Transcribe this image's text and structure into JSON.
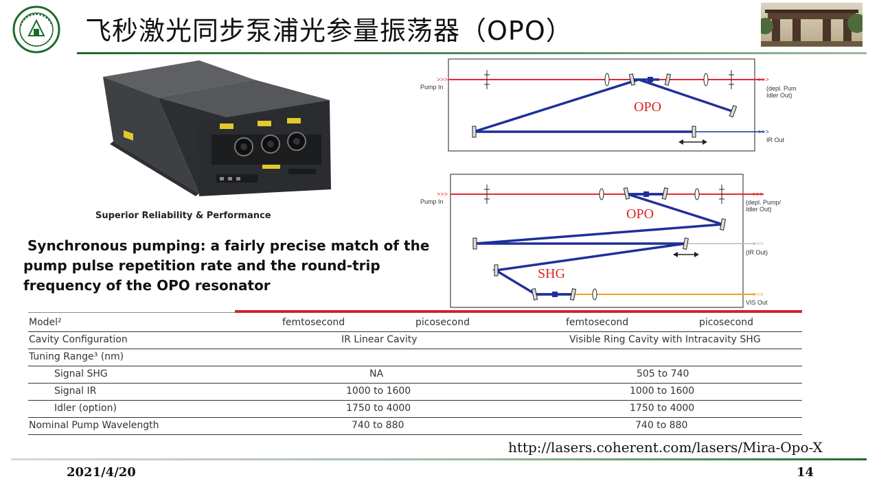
{
  "header": {
    "title": "飞秒激光同步泵浦光参量振荡器（OPO）"
  },
  "product": {
    "caption": "Superior Reliability & Performance"
  },
  "description": {
    "line1": "Synchronous pumping: a fairly precise match of the",
    "line2": "pump pulse repetition rate and the round-trip",
    "line3": "frequency of the OPO resonator"
  },
  "diagram_top": {
    "pump_in": "Pump In",
    "depl_pump_1": "(depl. Pump/",
    "depl_pump_2": "Idler Out)",
    "ir_out": "IR Out",
    "cavity_label": "OPO",
    "arrow_marks": ">>>"
  },
  "diagram_bottom": {
    "pump_in": "Pump In",
    "depl_pump_1": "(depl. Pump/",
    "depl_pump_2": "Idler Out)",
    "ir_out": "(IR Out)",
    "vis_out": "VIS Out",
    "cavity_label": "OPO",
    "shg_label": "SHG",
    "arrow_marks": ">>>"
  },
  "table": {
    "model": {
      "label": "Model²",
      "c1": "femtosecond",
      "c2": "picosecond",
      "c3": "femtosecond",
      "c4": "picosecond"
    },
    "cavity": {
      "label": "Cavity Configuration",
      "left": "IR Linear Cavity",
      "right": "Visible Ring Cavity with Intracavity SHG"
    },
    "tuning": {
      "label": "Tuning Range³ (nm)"
    },
    "signal_shg": {
      "label": "Signal SHG",
      "left": "NA",
      "right": "505 to 740"
    },
    "signal_ir": {
      "label": "Signal IR",
      "left": "1000 to 1600",
      "right": "1000 to 1600"
    },
    "idler": {
      "label": "Idler (option)",
      "left": "1750 to 4000",
      "right": "1750 to 4000"
    },
    "pump": {
      "label": "Nominal Pump Wavelength",
      "left": "740 to 880",
      "right": "740 to 880"
    }
  },
  "source_url": "http://lasers.coherent.com/lasers/Mira-Opo-X",
  "footer": {
    "date": "2021/4/20",
    "page": "14"
  },
  "colors": {
    "pump_beam": "#e8262c",
    "cavity_beam": "#1f2f9a",
    "visible_beam": "#f0a020",
    "ir_beam": "#1f2f9a",
    "accent_red": "#c9262c",
    "brand_green": "#1a6b2c"
  }
}
